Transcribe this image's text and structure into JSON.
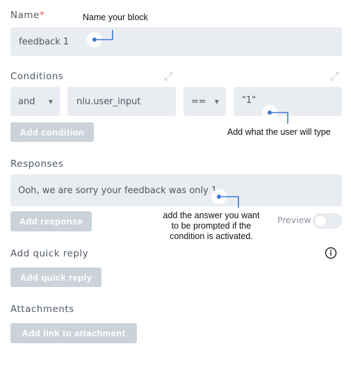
{
  "name_section": {
    "label": "Name",
    "required_mark": "*",
    "value": "feedback 1",
    "annotation": "Name your block"
  },
  "conditions": {
    "label": "Conditions",
    "operator_select": "and",
    "variable_input": "nlu.user_input",
    "comparator_select": "==",
    "value_input": "\"1\"",
    "add_button": "Add condition",
    "annotation": "Add what the user will type"
  },
  "responses": {
    "label": "Responses",
    "value": "Ooh, we are sorry your feedback was only 1.",
    "add_button": "Add response",
    "preview_label": "Preview",
    "preview_on": false,
    "annotation_lines": [
      "add the answer you want",
      "to be prompted if the",
      "condition is activated."
    ]
  },
  "quick_reply": {
    "label": "Add quick reply",
    "button": "Add quick reply"
  },
  "attachments": {
    "label": "Attachments",
    "button": "Add link to attachment"
  },
  "colors": {
    "field_bg": "#e9edf2",
    "button_bg": "#ccd2d9",
    "pointer_blue": "#3a7bd5",
    "required_red": "#e64d5a"
  },
  "icons": [
    "expand-icon",
    "caret-down-icon",
    "info-icon",
    "pointer-dot-icon"
  ]
}
